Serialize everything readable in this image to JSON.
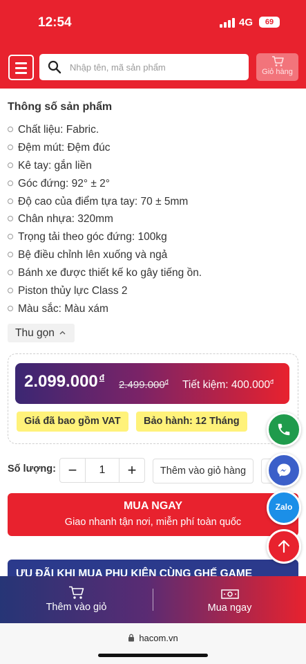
{
  "status_bar": {
    "time": "12:54",
    "network": "4G",
    "battery": "69"
  },
  "header": {
    "search_placeholder": "Nhập tên, mã sản phẩm",
    "cart_label": "Giỏ hàng"
  },
  "specs": {
    "title": "Thông số sản phẩm",
    "items": [
      "Chất liệu: Fabric.",
      "Đệm mút: Đệm đúc",
      "Kê tay: gắn liền",
      "Góc đứng: 92° ± 2°",
      "Độ cao của điểm tựa tay: 70 ± 5mm",
      "Chân nhựa: 320mm",
      "Trọng tải theo góc đứng: 100kg",
      "Bệ điều chỉnh lên xuống và ngả",
      "Bánh xe được thiết kế ko gây tiếng ồn.",
      "Piston thủy lực Class 2",
      "Màu sắc: Màu xám"
    ],
    "collapse_label": "Thu gọn"
  },
  "price": {
    "current": "2.099.000",
    "currency": "đ",
    "old": "2.499.000",
    "saving": "Tiết kiệm: 400.000",
    "tags": [
      "Giá đã bao gồm VAT",
      "Bảo hành: 12 Tháng"
    ]
  },
  "purchase": {
    "qty_label": "Số lượng:",
    "minus": "−",
    "plus": "+",
    "qty_value": "1",
    "add_to_cart": "Thêm vào giỏ hàng",
    "buy_now_title": "MUA NGAY",
    "buy_now_sub": "Giao nhanh tận nơi, miễn phí toàn quốc"
  },
  "promo_banner": "ƯU ĐÃI KHI MUA PHỤ KIỆN CÙNG GHẾ GAME",
  "floating": {
    "zalo_label": "Zalo"
  },
  "bottom_bar": {
    "add_to_cart": "Thêm vào giỏ",
    "buy_now": "Mua ngay"
  },
  "browser": {
    "url": "hacom.vn"
  },
  "colors": {
    "brand_red": "#e8222e",
    "navy": "#263576",
    "tag_yellow": "#fff27a",
    "phone_green": "#1f9b4c",
    "messenger_blue": "#3b5fc9",
    "zalo_blue": "#1b8fe8"
  }
}
